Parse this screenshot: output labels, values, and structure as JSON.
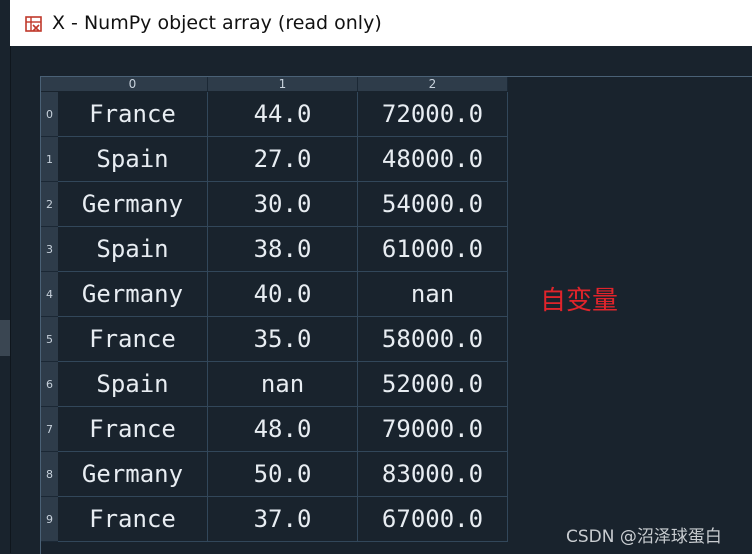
{
  "window": {
    "title": "X - NumPy object array (read only)",
    "icon": "spyder-grid-icon"
  },
  "table": {
    "columns": [
      "0",
      "1",
      "2"
    ],
    "rows": [
      {
        "index": "0",
        "cells": [
          "France",
          "44.0",
          "72000.0"
        ]
      },
      {
        "index": "1",
        "cells": [
          "Spain",
          "27.0",
          "48000.0"
        ]
      },
      {
        "index": "2",
        "cells": [
          "Germany",
          "30.0",
          "54000.0"
        ]
      },
      {
        "index": "3",
        "cells": [
          "Spain",
          "38.0",
          "61000.0"
        ]
      },
      {
        "index": "4",
        "cells": [
          "Germany",
          "40.0",
          "nan"
        ]
      },
      {
        "index": "5",
        "cells": [
          "France",
          "35.0",
          "58000.0"
        ]
      },
      {
        "index": "6",
        "cells": [
          "Spain",
          "nan",
          "52000.0"
        ]
      },
      {
        "index": "7",
        "cells": [
          "France",
          "48.0",
          "79000.0"
        ]
      },
      {
        "index": "8",
        "cells": [
          "Germany",
          "50.0",
          "83000.0"
        ]
      },
      {
        "index": "9",
        "cells": [
          "France",
          "37.0",
          "67000.0"
        ]
      }
    ]
  },
  "annotation": {
    "text": "自变量",
    "color": "#e0242b"
  },
  "watermark": "CSDN @沼泽球蛋白",
  "colors": {
    "background": "#19232d",
    "header": "#2e3c4a",
    "grid": "#32475a",
    "cell_text": "#e8edf2"
  }
}
